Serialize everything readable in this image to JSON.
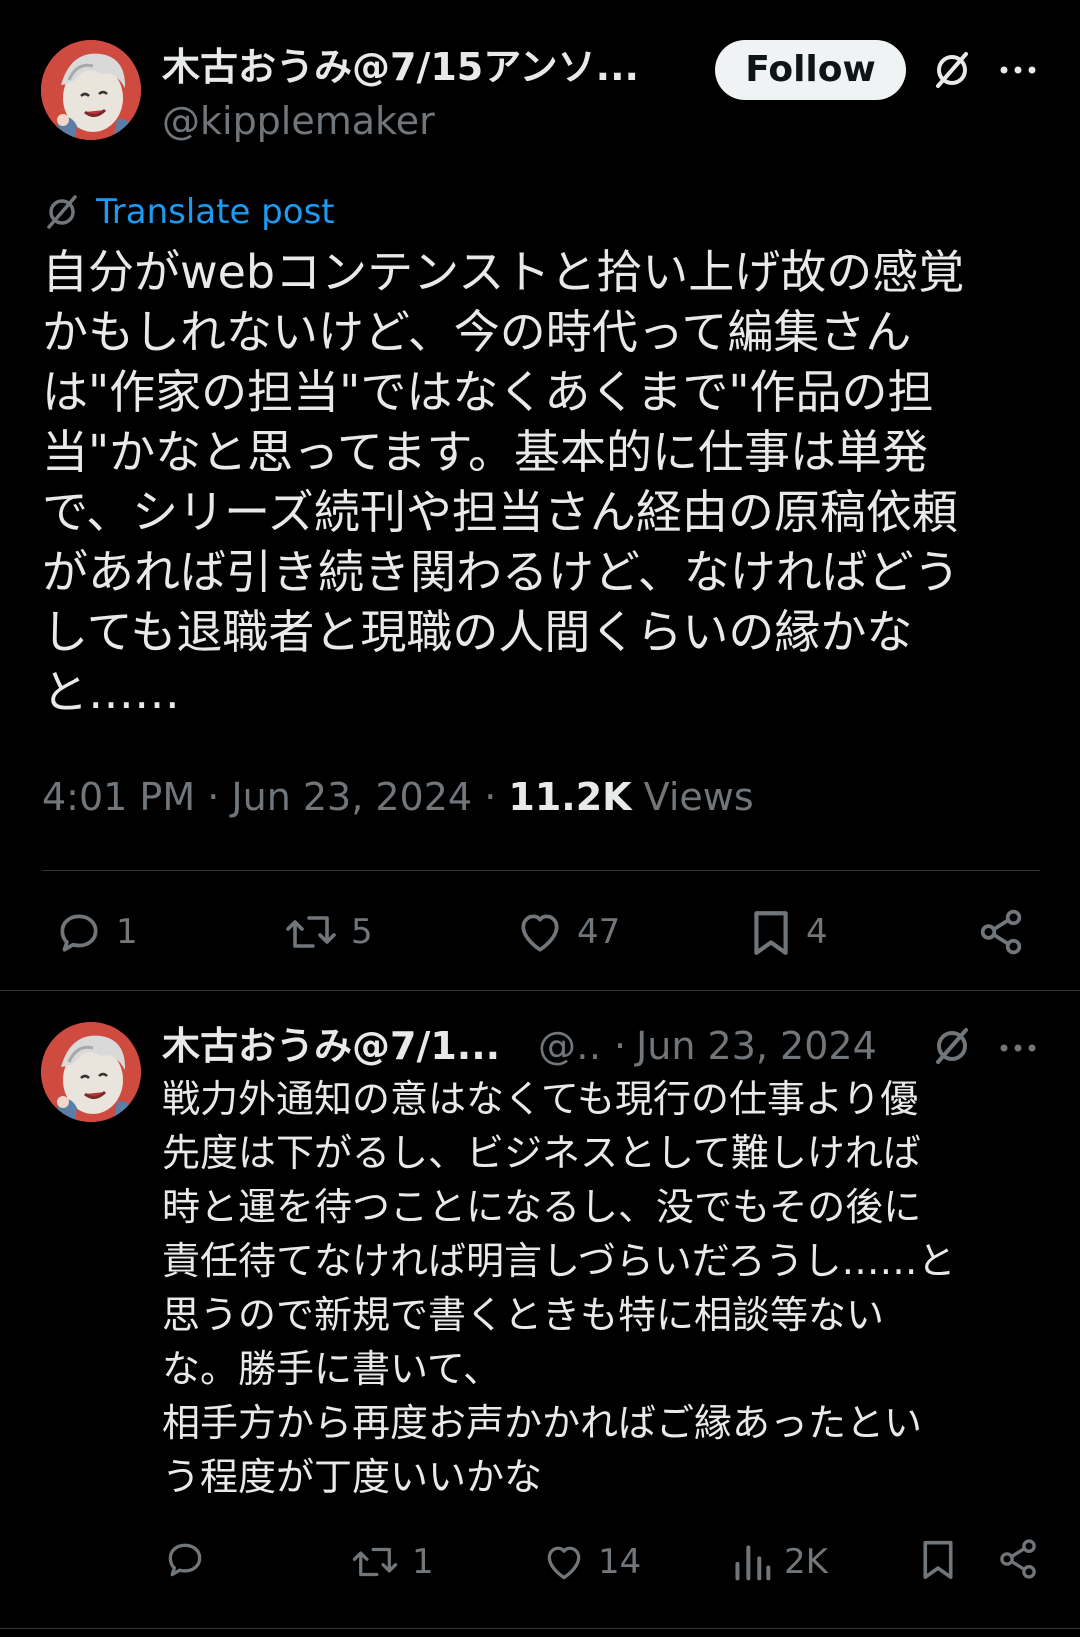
{
  "colors": {
    "background": "#000000",
    "text_primary": "#e7e9ea",
    "text_secondary": "#71767b",
    "link": "#1d9bf0",
    "divider": "#2f3336",
    "follow_button_bg": "#eff3f4"
  },
  "main_post": {
    "author_name": "木古おうみ@7/15アンソ...",
    "author_handle": "@kipplemaker",
    "follow_label": "Follow",
    "avatar_icon": "avatar-illustration",
    "grok_icon": "grok-slash-icon",
    "more_icon": "more-dots-icon",
    "translate_label": "Translate post",
    "text": "自分がwebコンテンストと拾い上げ故の感覚\nかもしれないけど、今の時代って編集さん\nは\"作家の担当\"ではなくあくまで\"作品の担\n当\"かなと思ってます。基本的に仕事は単発\nで、シリーズ続刊や担当さん経由の原稿依頼\nがあれば引き続き関わるけど、なければどう\nしても退職者と現職の人間くらいの縁かな\nと……",
    "time": "4:01 PM",
    "date": "Jun 23, 2024",
    "separator": "·",
    "views_count": "11.2K",
    "views_label": "Views",
    "actions": {
      "replies": "1",
      "reposts": "5",
      "likes": "47",
      "bookmarks": "4"
    }
  },
  "reply_post": {
    "author_name": "木古おうみ@7/1...",
    "author_handle": "@...",
    "separator": "·",
    "date": "Jun 23, 2024",
    "text": "戦力外通知の意はなくても現行の仕事より優\n先度は下がるし、ビジネスとして難しければ\n時と運を待つことになるし、没でもその後に\n責任待てなければ明言しづらいだろうし……と\n思うので新規で書くときも特に相談等ない\nな。勝手に書いて、\n相手方から再度お声かかればご縁あったとい\nう程度が丁度いいかな",
    "actions": {
      "replies": "",
      "reposts": "1",
      "likes": "14",
      "views": "2K"
    }
  }
}
